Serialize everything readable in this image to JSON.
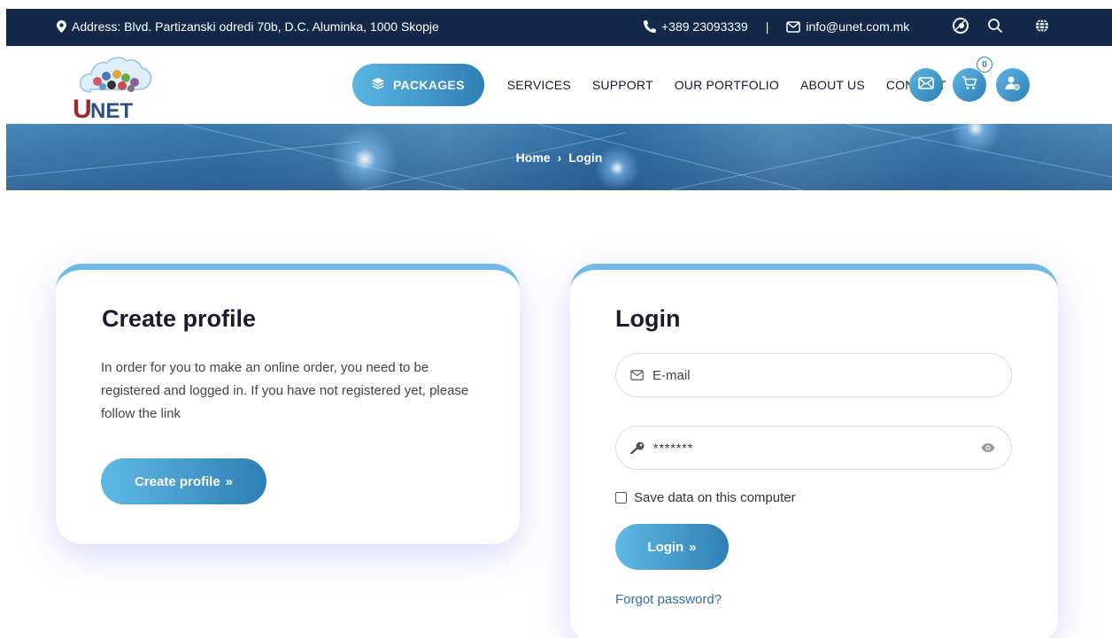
{
  "topbar": {
    "address": "Address: Blvd. Partizanski odredi 70b, D.C. Aluminka, 1000 Skopje",
    "phone": "+389 23093339",
    "separator": "|",
    "email": "info@unet.com.mk",
    "icons": [
      "map-pin-icon",
      "phone-icon",
      "envelope-icon",
      "accessibility-icon",
      "search-icon",
      "globe-icon"
    ]
  },
  "header": {
    "logo_text": "UNET",
    "nav": {
      "packages": "PACKAGES",
      "services": "SERVICES",
      "support": "SUPPORT",
      "portfolio": "OUR PORTFOLIO",
      "about": "ABOUT US",
      "contact": "CONTACT"
    },
    "cart_count": "0",
    "icons": [
      "layers-icon",
      "mail-icon",
      "cart-icon",
      "user-settings-icon"
    ]
  },
  "breadcrumb": {
    "home": "Home",
    "separator": "›",
    "current": "Login"
  },
  "create_profile": {
    "title": "Create profile",
    "description": "In order for you to make an online order, you need to be registered and logged in. If you have not registered yet, please follow the link",
    "button": "Create profile",
    "button_arrow": "»"
  },
  "login": {
    "title": "Login",
    "email_placeholder": "E-mail",
    "password_value": "*******",
    "save_label": "Save data on this computer",
    "button": "Login",
    "button_arrow": "»",
    "forgot": "Forgot password?"
  },
  "colors": {
    "topbar_bg": "#14284a",
    "accent": "#2f7fb6",
    "accent_light": "#5bb6e3",
    "card_border": "#6fb9e6",
    "link": "#2f6fa6"
  }
}
